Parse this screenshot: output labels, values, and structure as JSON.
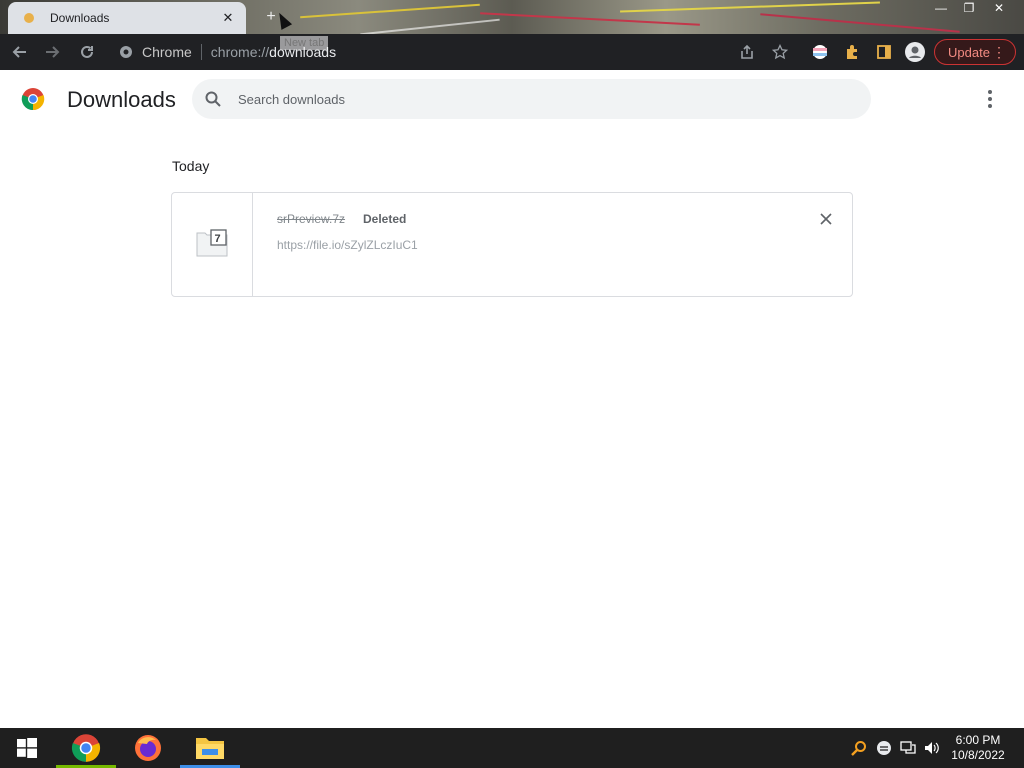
{
  "browser": {
    "tab_title": "Downloads",
    "tab_close": "✕",
    "new_tab_symbol": "+",
    "new_tab_tooltip": "New tab",
    "omnibox_chip": "Chrome",
    "url_scheme": "chrome://",
    "url_host": "downloads",
    "update_label": "Update",
    "update_menu": "⋮"
  },
  "page": {
    "title": "Downloads",
    "search_placeholder": "Search downloads",
    "section_date": "Today",
    "downloads": [
      {
        "file_name": "srPreview.7z",
        "status": "Deleted",
        "url": "https://file.io/sZylZLczIuC1",
        "icon": "7z-file-icon"
      }
    ]
  },
  "taskbar": {
    "time": "6:00 PM",
    "date": "10/8/2022",
    "apps": [
      "chrome",
      "firefox",
      "file-explorer"
    ]
  },
  "colors": {
    "accent_update": "#f28b82",
    "toolbar_bg": "#202124",
    "taskbar_bg": "#1f1f1f",
    "chrome_underline": "#76b900",
    "explorer_underline": "#3d8ee8"
  }
}
